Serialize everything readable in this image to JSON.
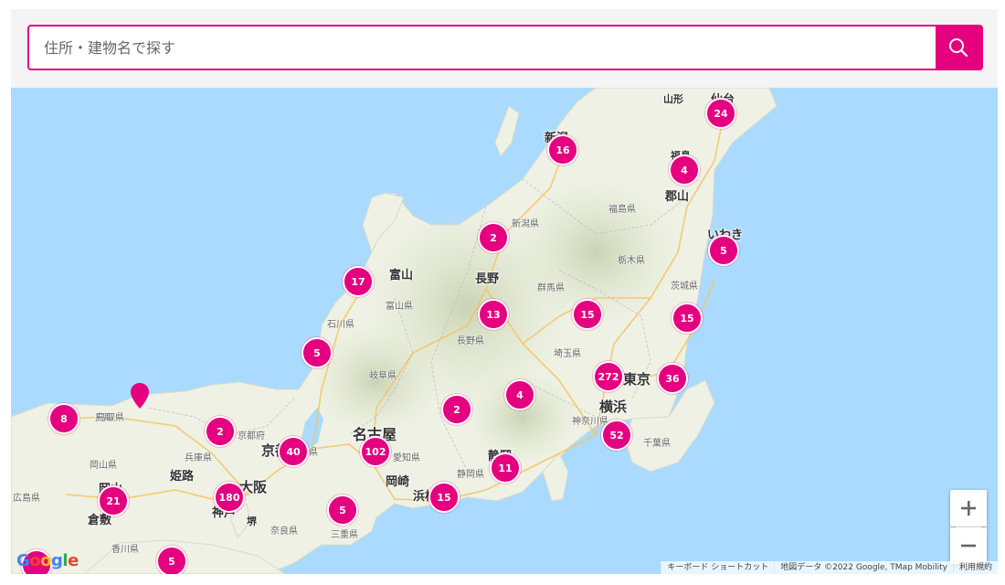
{
  "search": {
    "placeholder": "住所・建物名で探す"
  },
  "colors": {
    "accent": "#e4007f",
    "sea": "#aadaff",
    "land": "#eef1e3"
  },
  "icons": {
    "search": "search-icon",
    "zoom_in": "plus-icon",
    "zoom_out": "minus-icon",
    "pin": "map-pin-icon"
  },
  "map": {
    "cities": [
      {
        "label": "山形"
      },
      {
        "label": "仙台"
      },
      {
        "label": "新潟"
      },
      {
        "label": "福島"
      },
      {
        "label": "郡山"
      },
      {
        "label": "いわき"
      },
      {
        "label": "富山"
      },
      {
        "label": "長野"
      },
      {
        "label": "名古屋"
      },
      {
        "label": "京都"
      },
      {
        "label": "大阪"
      },
      {
        "label": "神戸"
      },
      {
        "label": "姫路"
      },
      {
        "label": "岡山"
      },
      {
        "label": "倉敷"
      },
      {
        "label": "横浜"
      },
      {
        "label": "東京"
      },
      {
        "label": "岡崎"
      },
      {
        "label": "静岡"
      },
      {
        "label": "浜松"
      },
      {
        "label": "堺"
      },
      {
        "label": "鳥取"
      }
    ],
    "prefectures": [
      {
        "label": "新潟県"
      },
      {
        "label": "福島県"
      },
      {
        "label": "栃木県"
      },
      {
        "label": "群馬県"
      },
      {
        "label": "茨城県"
      },
      {
        "label": "富山県"
      },
      {
        "label": "石川県"
      },
      {
        "label": "長野県"
      },
      {
        "label": "埼玉県"
      },
      {
        "label": "岐阜県"
      },
      {
        "label": "神奈川県"
      },
      {
        "label": "千葉県"
      },
      {
        "label": "愛知県"
      },
      {
        "label": "静岡県"
      },
      {
        "label": "京都府"
      },
      {
        "label": "兵庫県"
      },
      {
        "label": "奈良県"
      },
      {
        "label": "三重県"
      },
      {
        "label": "鳥取県"
      },
      {
        "label": "岡山県"
      },
      {
        "label": "滋賀県"
      },
      {
        "label": "香川県"
      },
      {
        "label": "広島県"
      }
    ],
    "clusters": [
      {
        "count": "24"
      },
      {
        "count": "16"
      },
      {
        "count": "4"
      },
      {
        "count": "2"
      },
      {
        "count": "5"
      },
      {
        "count": "17"
      },
      {
        "count": "13"
      },
      {
        "count": "15"
      },
      {
        "count": "15"
      },
      {
        "count": "5"
      },
      {
        "count": "272"
      },
      {
        "count": "36"
      },
      {
        "count": "2"
      },
      {
        "count": "4"
      },
      {
        "count": "8"
      },
      {
        "count": "2"
      },
      {
        "count": "40"
      },
      {
        "count": "102"
      },
      {
        "count": "52"
      },
      {
        "count": "11"
      },
      {
        "count": "21"
      },
      {
        "count": "180"
      },
      {
        "count": "15"
      },
      {
        "count": "5"
      },
      {
        "count": "5"
      }
    ]
  },
  "attribution": {
    "logo": "Google",
    "shortcuts": "キーボード ショートカット",
    "data": "地図データ ©2022 Google, TMap Mobility",
    "terms": "利用規約"
  },
  "controls": {
    "zoom_in": "+",
    "zoom_out": "−"
  }
}
